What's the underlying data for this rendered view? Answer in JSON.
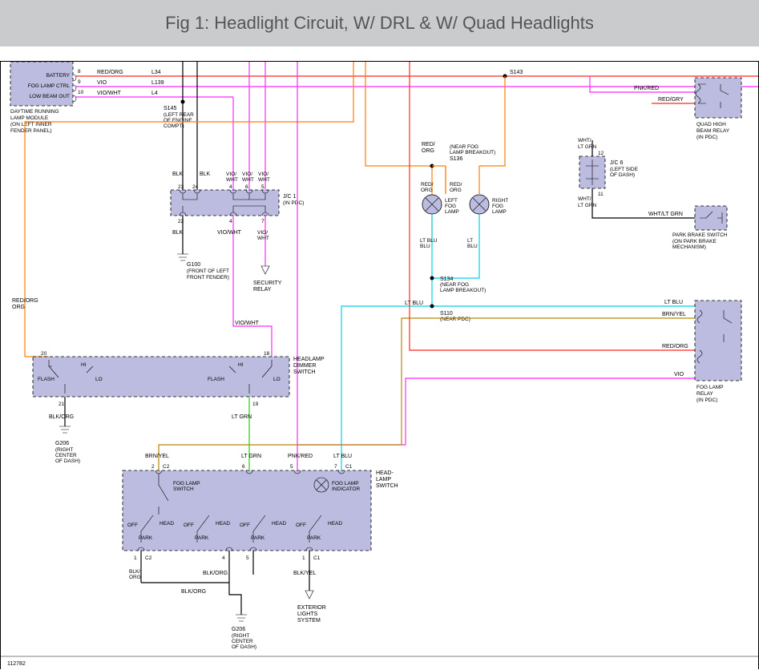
{
  "title": "Fig 1: Headlight Circuit, W/ DRL & W/ Quad Headlights",
  "drawing_no": "112782",
  "colors": {
    "red_org": "#ff281f",
    "pnk_red": "#ff28ff",
    "vio": "#ff28ff",
    "vio_wht": "#ff28ff",
    "blk": "#000000",
    "lt_grn": "#14dc00",
    "brn_yel": "#b8860b",
    "lt_blu": "#00d2e6",
    "red_gry": "#ff281f",
    "wht_lt_grn": "#000000"
  },
  "components": {
    "drl_module": {
      "name": "DAYTIME RUNNING",
      "name2": "LAMP MODULE",
      "loc": "(ON LEFT INNER",
      "loc2": "FENDER PANEL)",
      "p8": "BATTERY",
      "p9": "FOG LAMP CTRL",
      "p10": "LOW BEAM OUT"
    },
    "quad_relay": {
      "name": "QUAD HIGH",
      "name2": "BEAM RELAY",
      "loc": "(IN PDC)"
    },
    "fog_relay": {
      "name": "FOG LAMP",
      "name2": "RELAY",
      "loc": "(IN PDC)"
    },
    "park_brake": {
      "name": "PARK BRAKE SWITCH",
      "loc": "(ON PARK BRAKE",
      "loc2": "MECHANISM)"
    },
    "jc6": {
      "name": "J/C 6",
      "loc": "(LEFT SIDE",
      "loc2": "OF DASH)"
    },
    "jc1": {
      "name": "J/C 1",
      "loc": "(IN PDC)"
    },
    "left_fog": {
      "name": "LEFT",
      "name2": "FOG",
      "name3": "LAMP"
    },
    "right_fog": {
      "name": "RIGHT",
      "name2": "FOG",
      "name3": "LAMP"
    },
    "dimmer": {
      "name": "HEADLAMP",
      "name2": "DIMMER",
      "name3": "SWITCH",
      "flash": "FLASH",
      "hi": "HI",
      "lo": "LO"
    },
    "headlamp_sw": {
      "name": "HEAD-",
      "name2": "LAMP",
      "name3": "SWITCH",
      "fog_sw": "FOG LAMP",
      "fog_sw2": "SWITCH",
      "fog_ind": "FOG LAMP",
      "fog_ind2": "INDICATOR",
      "off": "OFF",
      "park": "PARK",
      "head": "HEAD"
    },
    "g100": {
      "name": "G100",
      "loc": "(FRONT OF LEFT",
      "loc2": "FRONT FENDER)"
    },
    "g206": {
      "name": "G206",
      "loc": "(RIGHT",
      "loc2": "CENTER",
      "loc3": "OF DASH)"
    },
    "ext_lights": {
      "name": "EXTERIOR",
      "name2": "LIGHTS",
      "name3": "SYSTEM"
    },
    "sec_relay": {
      "name": "SECURITY",
      "name2": "RELAY"
    }
  },
  "splices": {
    "s145": {
      "id": "S145",
      "loc": "(LEFT REAR",
      "loc2": "OF ENGINE",
      "loc3": "COMPT)"
    },
    "s143": {
      "id": "S143"
    },
    "s136": {
      "id": "S136",
      "loc": "(NEAR FOG",
      "loc2": "LAMP BREAKOUT)"
    },
    "s134": {
      "id": "S134",
      "loc": "(NEAR FOG",
      "loc2": "LAMP BREAKOUT)"
    },
    "s110": {
      "id": "S110",
      "loc": "(NEAR PDC)"
    }
  },
  "wires": {
    "red_org": "RED/ORG",
    "vio": "VIO",
    "vio_wht": "VIO/WHT",
    "blk": "BLK",
    "pnk_red": "PNK/RED",
    "red_gry": "RED/GRY",
    "wht_lt_grn": "WHT/",
    "wht_lt_grn2": "LT GRN",
    "wht_lt_grn_full": "WHT/LT GRN",
    "lt_blu": "LT BLU",
    "lt_grn": "LT GRN",
    "brn_yel": "BRN/YEL",
    "blk_org": "BLK/ORG",
    "blk_yel": "BLK/YEL",
    "vio_wht_stacked": "VIO/",
    "vio_wht_stacked2": "WHT",
    "l34": "L34",
    "l139": "L139",
    "l4": "L4"
  },
  "pins": {
    "p8": "8",
    "p9": "9",
    "p10": "10",
    "p23": "23",
    "p24": "24",
    "p4": "4",
    "p5": "5",
    "p6": "6",
    "p22": "22",
    "p7": "7",
    "p20": "20",
    "p18": "18",
    "p21": "21",
    "p19": "19",
    "p12": "12",
    "p11": "11",
    "p2": "2",
    "p1": "1",
    "c1": "C1",
    "c2": "C2"
  }
}
